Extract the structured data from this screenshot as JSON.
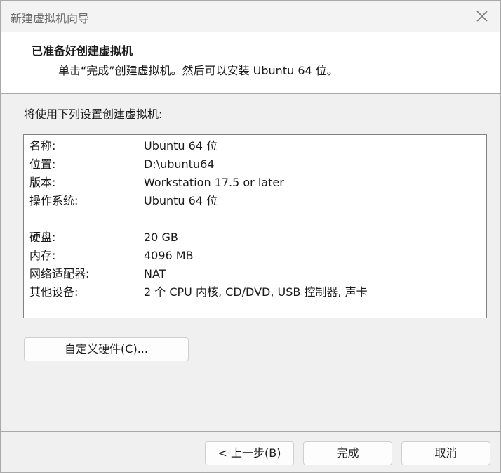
{
  "window": {
    "title": "新建虚拟机向导",
    "close_icon": "close-icon"
  },
  "header": {
    "title": "已准备好创建虚拟机",
    "subtitle": "单击“完成”创建虚拟机。然后可以安装 Ubuntu 64 位。"
  },
  "main": {
    "intro": "将使用下列设置创建虚拟机:",
    "settings": [
      {
        "label": "名称:",
        "value": "Ubuntu 64 位"
      },
      {
        "label": "位置:",
        "value": "D:\\ubuntu64"
      },
      {
        "label": "版本:",
        "value": "Workstation 17.5 or later"
      },
      {
        "label": "操作系统:",
        "value": "Ubuntu 64 位"
      },
      {
        "label": "硬盘:",
        "value": "20 GB"
      },
      {
        "label": "内存:",
        "value": "4096 MB"
      },
      {
        "label": "网络适配器:",
        "value": "NAT"
      },
      {
        "label": "其他设备:",
        "value": "2 个 CPU 内核, CD/DVD, USB 控制器, 声卡"
      }
    ],
    "customize_button": "自定义硬件(C)..."
  },
  "footer": {
    "back_button": "< 上一步(B)",
    "finish_button": "完成",
    "cancel_button": "取消"
  }
}
